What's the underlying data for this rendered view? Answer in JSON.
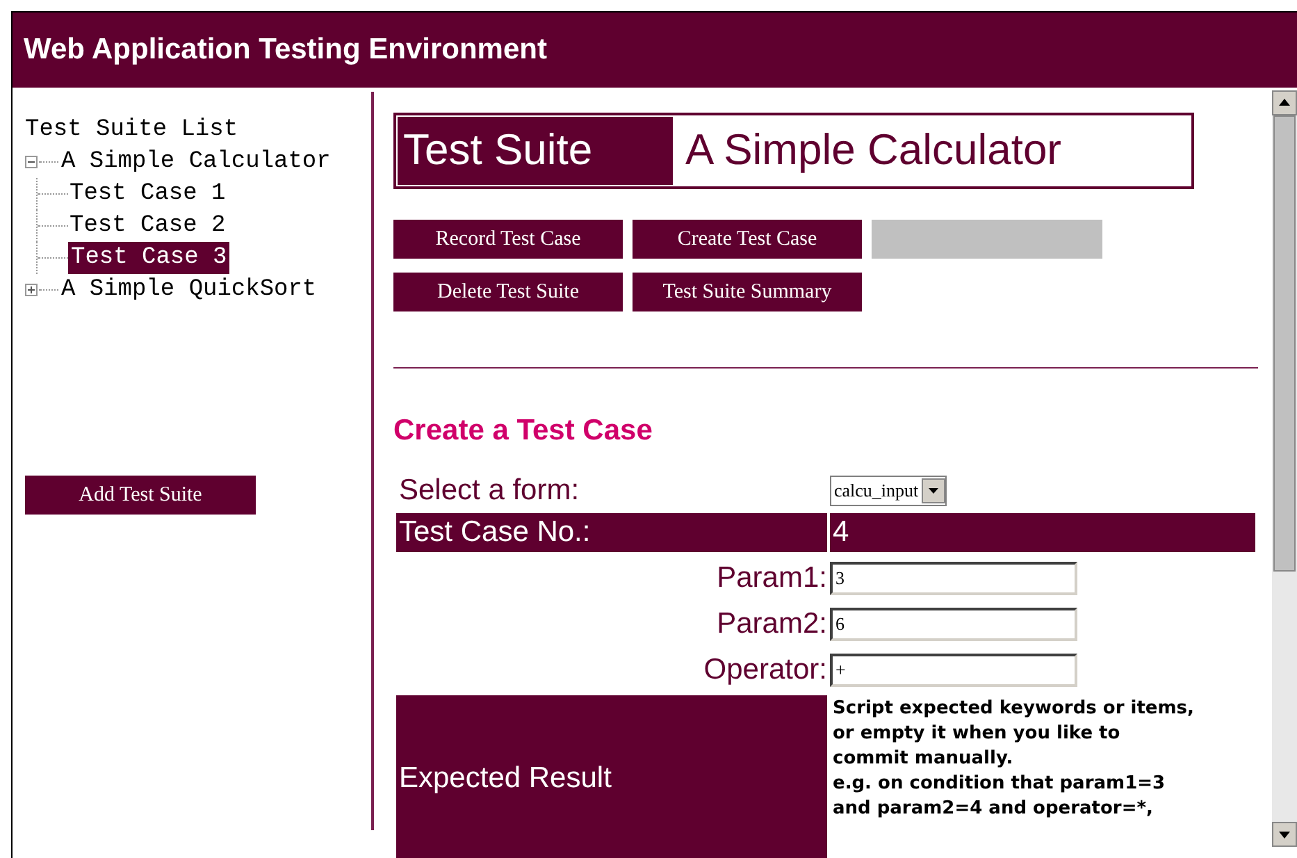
{
  "header": {
    "title": "Web Application Testing Environment"
  },
  "sidebar": {
    "heading": "Test Suite List",
    "tree": [
      {
        "label": "A Simple Calculator",
        "expanded": true,
        "selected": false,
        "children": [
          {
            "label": "Test Case 1",
            "selected": false
          },
          {
            "label": "Test Case 2",
            "selected": false
          },
          {
            "label": "Test Case 3",
            "selected": true
          }
        ]
      },
      {
        "label": "A Simple QuickSort",
        "expanded": false,
        "selected": false
      }
    ],
    "add_button": "Add Test Suite"
  },
  "suite_header": {
    "label": "Test Suite",
    "name": "A Simple Calculator"
  },
  "actions": [
    {
      "kind": "button",
      "label": "Record Test Case"
    },
    {
      "kind": "button",
      "label": "Create Test Case"
    },
    {
      "kind": "blank"
    },
    {
      "kind": "button",
      "label": "Delete Test Suite"
    },
    {
      "kind": "button",
      "label": "Test Suite Summary"
    }
  ],
  "form": {
    "title": "Create a Test Case",
    "select": {
      "label": "Select a form:",
      "value": "calcu_input"
    },
    "case_no": {
      "label": "Test Case No.:",
      "value": "4"
    },
    "params": [
      {
        "label": "Param1:",
        "value": "3"
      },
      {
        "label": "Param2:",
        "value": "6"
      },
      {
        "label": "Operator:",
        "value": "+"
      }
    ],
    "expected": {
      "label": "Expected Result",
      "hint": "Script expected keywords or items,\nor empty it when you like to\ncommit manually.\ne.g. on condition that param1=3\nand param2=4 and operator=*,"
    }
  }
}
